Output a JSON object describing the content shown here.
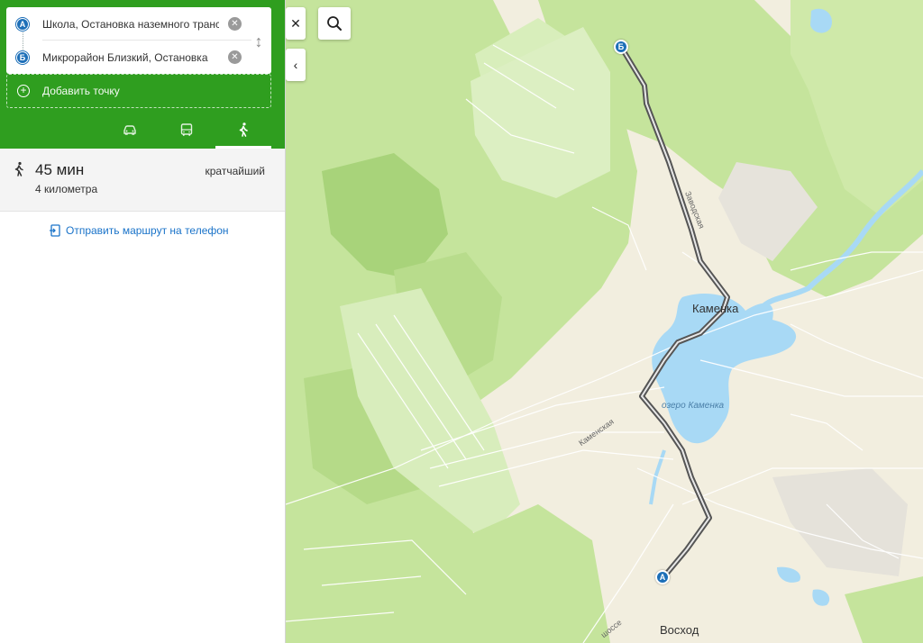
{
  "route": {
    "point_a": {
      "marker": "А",
      "text": "Школа, Остановка наземного транспорта"
    },
    "point_b": {
      "marker": "Б",
      "text": "Микрорайон Близкий, Остановка"
    },
    "swap_icon": "swap-vertical-icon",
    "add_point_label": "Добавить точку",
    "modes": [
      {
        "name": "car",
        "icon": "car-icon",
        "active": false
      },
      {
        "name": "bus",
        "icon": "bus-icon",
        "active": false
      },
      {
        "name": "walk",
        "icon": "walk-icon",
        "active": true
      }
    ]
  },
  "result": {
    "time": "45 мин",
    "distance": "4 километра",
    "tag": "кратчайший"
  },
  "send_to_phone_label": "Отправить маршрут на телефон",
  "map": {
    "labels": {
      "kamenka": "Каменка",
      "lake": "озеро Каменка",
      "voskhod": "Восход",
      "zavodskaya": "Заводская",
      "kamenskaya": "Каменская",
      "shosse": "шоссе"
    },
    "markers": {
      "a": "А",
      "b": "Б"
    },
    "controls": {
      "close": "✕",
      "collapse": "‹"
    }
  },
  "colors": {
    "route_header": "#2f9e1f",
    "marker": "#1d6fb8",
    "link": "#1a73c9",
    "forest": "#c5e49c",
    "forest_dark": "#a8d37a",
    "water": "#a8d9f5",
    "land": "#f2eedf"
  }
}
